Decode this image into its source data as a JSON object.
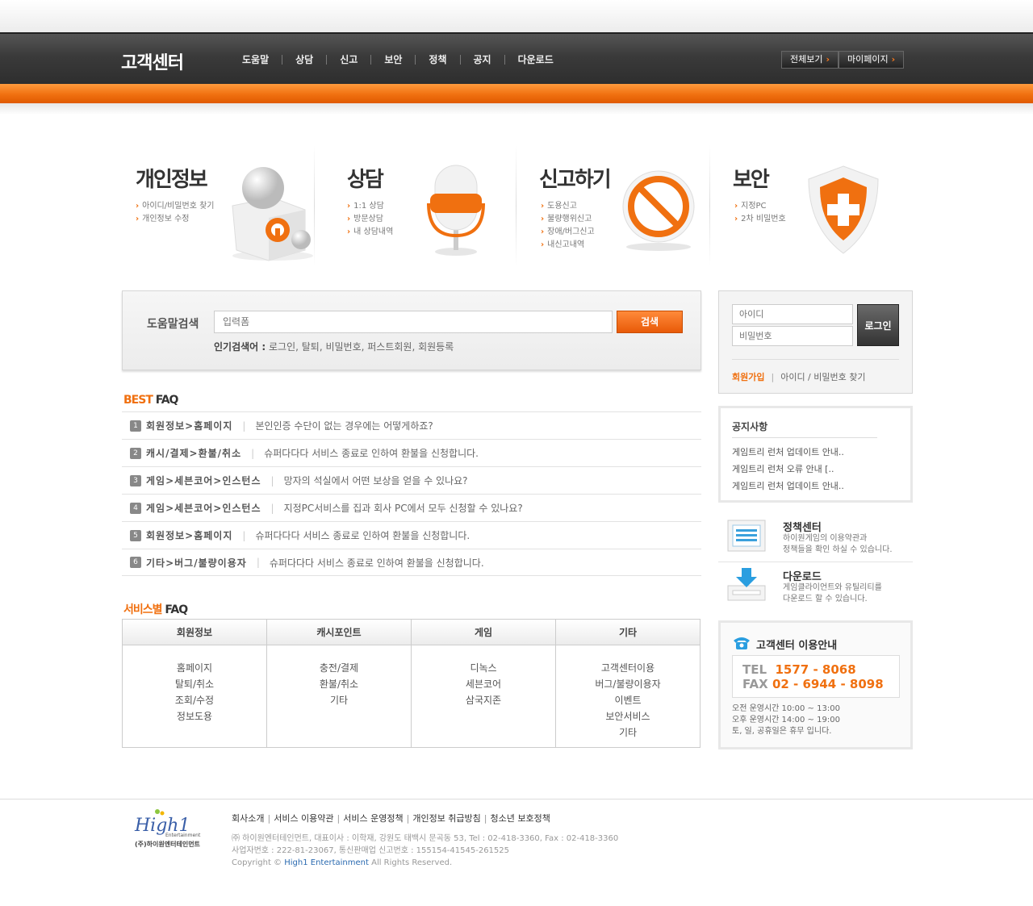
{
  "header": {
    "logo": "고객센터",
    "nav": [
      "도움말",
      "상담",
      "신고",
      "보안",
      "정책",
      "공지",
      "다운로드"
    ],
    "btn_all": "전체보기",
    "btn_mypage": "마이페이지"
  },
  "categories": [
    {
      "title": "개인정보",
      "items": [
        "아이디/비밀번호 찾기",
        "개인정보 수정"
      ]
    },
    {
      "title": "상담",
      "items": [
        "1:1 상담",
        "방문상담",
        "내 상담내역"
      ]
    },
    {
      "title": "신고하기",
      "items": [
        "도용신고",
        "불량행위신고",
        "장애/버그신고",
        "내신고내역"
      ]
    },
    {
      "title": "보안",
      "items": [
        "지정PC",
        "2차 비밀번호"
      ]
    }
  ],
  "search": {
    "label": "도움말검색",
    "placeholder": "입력폼",
    "button": "검색",
    "popular_label": "인기검색어 :",
    "popular": "로그인,  탈퇴,  비밀번호,  퍼스트회원,  회원등록"
  },
  "best_faq": {
    "title_o": "BEST",
    "title": " FAQ",
    "items": [
      {
        "num": "1",
        "cat": "회원정보>홈페이지",
        "q": "본인인증 수단이 없는 경우에는 어떻게하죠?"
      },
      {
        "num": "2",
        "cat": "캐시/결제>환불/취소",
        "q": "슈퍼다다다 서비스 종료로 인하여 환불을 신청합니다."
      },
      {
        "num": "3",
        "cat": "게임>세븐코어>인스턴스",
        "q": "망자의 석실에서 어떤 보상을 얻을 수 있나요?"
      },
      {
        "num": "4",
        "cat": "게임>세븐코어>인스턴스",
        "q": "지정PC서비스를 집과 회사 PC에서 모두 신청할 수 있나요?"
      },
      {
        "num": "5",
        "cat": "회원정보>홈페이지",
        "q": "슈퍼다다다 서비스 종료로 인하여 환불을 신청합니다."
      },
      {
        "num": "6",
        "cat": "기타>버그/불량이용자",
        "q": "슈퍼다다다 서비스 종료로 인하여 환불을 신청합니다."
      }
    ]
  },
  "service_faq": {
    "title_o": "서비스별",
    "title": " FAQ",
    "columns": [
      {
        "header": "회원정보",
        "items": [
          "홈페이지",
          "탈퇴/취소",
          "조회/수정",
          "정보도용"
        ]
      },
      {
        "header": "캐시포인트",
        "items": [
          "충전/결제",
          "환불/취소",
          "기타"
        ]
      },
      {
        "header": "게임",
        "items": [
          "디녹스",
          "세븐코어",
          "삼국지존"
        ]
      },
      {
        "header": "기타",
        "items": [
          "고객센터이용",
          "버그/불량이용자",
          "이벤트",
          "보안서비스",
          "기타"
        ]
      }
    ]
  },
  "login": {
    "id_placeholder": "아이디",
    "pw_placeholder": "비밀번호",
    "button": "로그인",
    "join": "회원가입",
    "find": "아이디 / 비밀번호 찾기"
  },
  "notice": {
    "title": "공지사항",
    "items": [
      "게임트리 런처 업데이트 안내..",
      "게임트리 런처 오류 안내 [..",
      "게임트리 런처 업데이트 안내.."
    ]
  },
  "policy": {
    "title": "정책센터",
    "desc1": "하이원게임의 이용약관과",
    "desc2": "정책들을 확인 하실 수 있습니다."
  },
  "download": {
    "title": "다운로드",
    "desc1": "게임클라이언트와 유틸리티를",
    "desc2": "다운로드 할 수 있습니다."
  },
  "cs": {
    "title": "고객센터 이용안내",
    "tel_label": "TEL",
    "tel": "1577 - 8068",
    "fax_label": "FAX",
    "fax": "02 - 6944 - 8098",
    "hours1": "오전 운영시간 10:00 ~ 13:00",
    "hours2": "오후 운영시간 14:00 ~ 19:00",
    "hours3": "토, 일, 공휴일은 휴무 입니다."
  },
  "footer": {
    "logo_text": "High1",
    "logo_sub": "Entertainment",
    "logo_kr": "(주)하이원엔터테인먼트",
    "links": [
      "회사소개",
      "서비스 이용약관",
      "서비스 운영정책",
      "개인정보 취급방침",
      "청소년 보호정책"
    ],
    "info1": "㈜ 하이원엔터테인먼트,  대표이사 : 이학재,  강원도 태백시 문곡동 53,  Tel : 02-418-3360,  Fax : 02-418-3360",
    "info2": "사업자번호 : 222-81-23067, 통신판매업 신고번호 : 155154-41545-261525",
    "copy_pre": "Copyright © ",
    "copy_brand": "High1 Entertainment",
    "copy_post": " All Rights Reserved."
  },
  "colors": {
    "accent": "#f07010",
    "header_bg": "#3a3a3a"
  }
}
